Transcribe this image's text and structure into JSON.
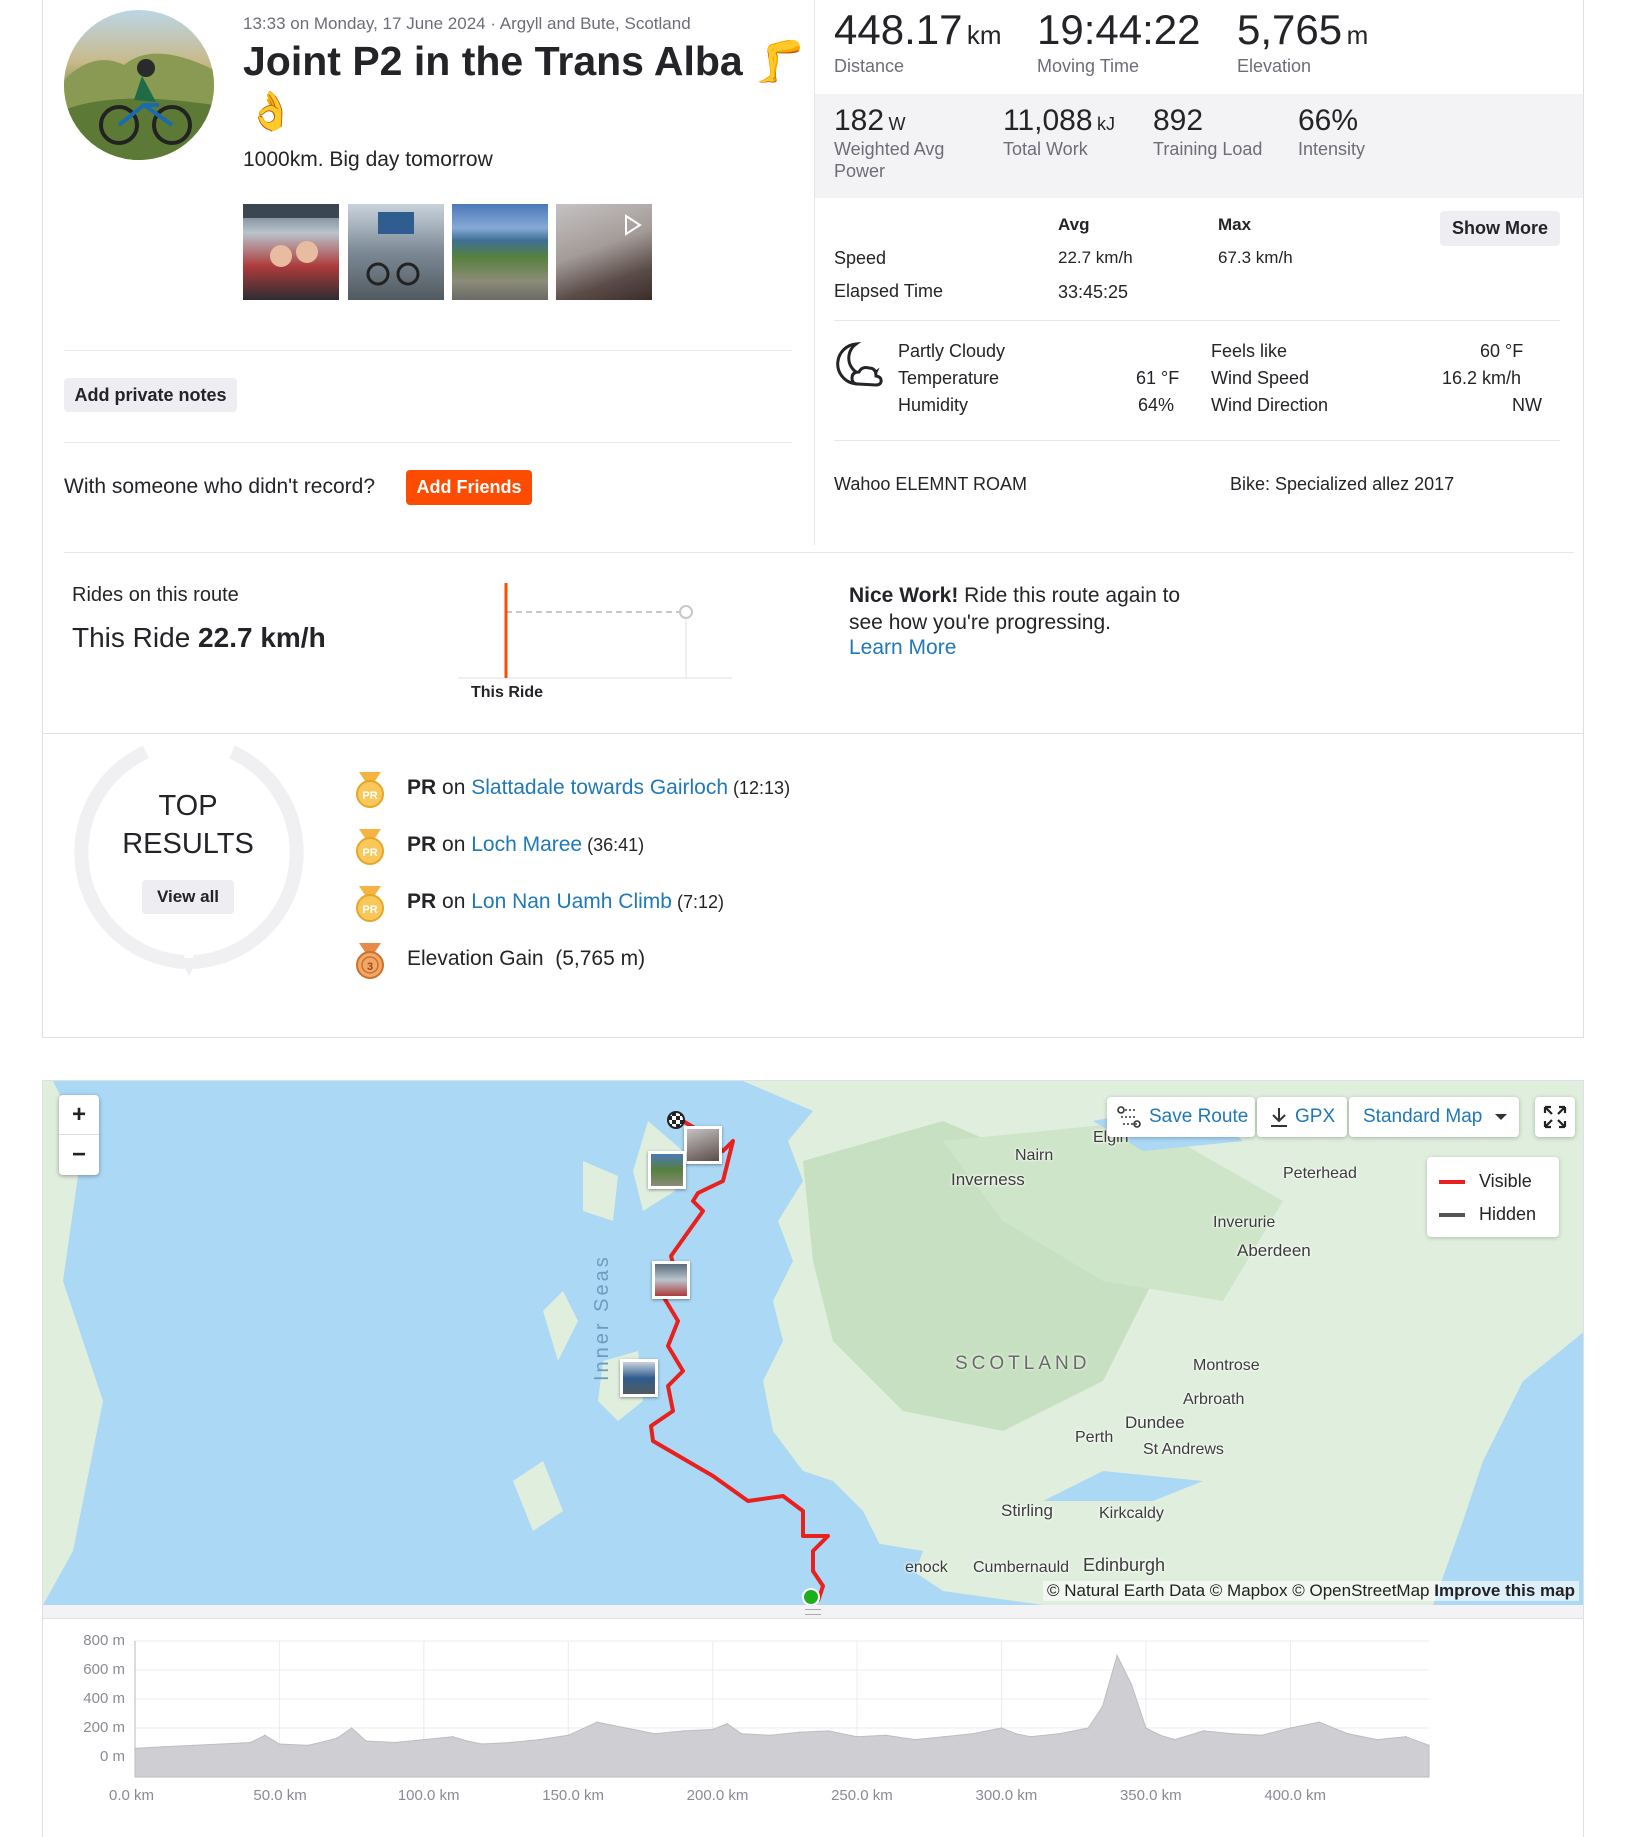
{
  "activity": {
    "meta": "13:33 on Monday, 17 June 2024 · Argyll and Bute, Scotland",
    "title": "Joint P2 in the Trans Alba 🦵",
    "title_emoji2": "👌",
    "description": "1000km. Big day tomorrow"
  },
  "actions": {
    "private_notes": "Add private notes",
    "someone_text": "With someone who didn't record?",
    "add_friends": "Add Friends"
  },
  "primary_stats": [
    {
      "value": "448.17",
      "unit": "km",
      "label": "Distance"
    },
    {
      "value": "19:44:22",
      "unit": "",
      "label": "Moving Time"
    },
    {
      "value": "5,765",
      "unit": "m",
      "label": "Elevation"
    }
  ],
  "secondary_stats": [
    {
      "value": "182",
      "unit": "W",
      "label": "Weighted Avg Power"
    },
    {
      "value": "11,088",
      "unit": "kJ",
      "label": "Total Work"
    },
    {
      "value": "892",
      "unit": "",
      "label": "Training Load"
    },
    {
      "value": "66%",
      "unit": "",
      "label": "Intensity"
    }
  ],
  "details": {
    "avg_header": "Avg",
    "max_header": "Max",
    "show_more": "Show More",
    "speed_label": "Speed",
    "speed_avg": "22.7 km/h",
    "speed_max": "67.3 km/h",
    "elapsed_label": "Elapsed Time",
    "elapsed_avg": "33:45:25"
  },
  "weather": {
    "condition": "Partly Cloudy",
    "temp_label": "Temperature",
    "temp_value": "61 °F",
    "humidity_label": "Humidity",
    "humidity_value": "64%",
    "feels_label": "Feels like",
    "feels_value": "60 °F",
    "wind_speed_label": "Wind Speed",
    "wind_speed_value": "16.2 km/h",
    "wind_dir_label": "Wind Direction",
    "wind_dir_value": "NW"
  },
  "gear": {
    "device": "Wahoo ELEMNT ROAM",
    "bike": "Bike: Specialized allez 2017"
  },
  "route": {
    "title": "Rides on this route",
    "this_ride_prefix": "This Ride",
    "this_ride_value": "22.7 km/h",
    "chart_label": "This Ride",
    "nice_work_bold": "Nice Work!",
    "nice_work_rest": " Ride this route again to see how you're progressing.",
    "learn_more": "Learn More"
  },
  "top_results": {
    "title_line1": "TOP",
    "title_line2": "RESULTS",
    "view_all": "View all",
    "items": [
      {
        "badge": "PR",
        "prefix": "PR",
        "on": " on ",
        "segment": "Slattadale towards Gairloch",
        "time": " (12:13)"
      },
      {
        "badge": "PR",
        "prefix": "PR",
        "on": " on ",
        "segment": "Loch Maree",
        "time": " (36:41)"
      },
      {
        "badge": "PR",
        "prefix": "PR",
        "on": " on ",
        "segment": "Lon Nan Uamh Climb",
        "time": " (7:12)"
      },
      {
        "badge": "3",
        "prefix": "",
        "on": "",
        "segment": "Elevation Gain  (5,765 m)",
        "time": ""
      }
    ]
  },
  "map": {
    "zoom_in": "+",
    "zoom_out": "−",
    "save_route": "Save Route",
    "gpx": "GPX",
    "map_type": "Standard Map",
    "legend_visible": "Visible",
    "legend_hidden": "Hidden",
    "attribution": "© Natural Earth Data © Mapbox © OpenStreetMap",
    "improve": "Improve this map",
    "sea_label": "Inner Seas",
    "country_label": "SCOTLAND",
    "cities": [
      "Elgin",
      "Nairn",
      "Inverness",
      "Peterhead",
      "Inverurie",
      "Aberdeen",
      "Montrose",
      "Arbroath",
      "Dundee",
      "Perth",
      "St Andrews",
      "Stirling",
      "Kirkcaldy",
      "Cumbernauld",
      "Edinburgh",
      "enock"
    ],
    "colors": {
      "visible": "#e8211e",
      "hidden": "#555555",
      "water": "#aad8f5",
      "land": "#dfeedd"
    }
  },
  "elevation_chart": {
    "y_ticks": [
      "800 m",
      "600 m",
      "400 m",
      "200 m",
      "0 m"
    ],
    "x_ticks": [
      "0.0 km",
      "50.0 km",
      "100.0 km",
      "150.0 km",
      "200.0 km",
      "250.0 km",
      "300.0 km",
      "350.0 km",
      "400.0 km"
    ]
  },
  "chart_data": {
    "type": "area",
    "xlabel": "",
    "ylabel": "",
    "xlim": [
      0,
      448
    ],
    "ylim": [
      0,
      800
    ],
    "x": [
      0,
      10,
      20,
      30,
      40,
      45,
      50,
      60,
      70,
      75,
      80,
      90,
      100,
      110,
      115,
      120,
      130,
      140,
      150,
      160,
      165,
      170,
      180,
      190,
      200,
      205,
      210,
      220,
      230,
      240,
      250,
      260,
      270,
      280,
      290,
      300,
      305,
      310,
      320,
      330,
      335,
      340,
      345,
      350,
      355,
      360,
      370,
      380,
      390,
      400,
      410,
      420,
      430,
      440,
      448
    ],
    "y": [
      60,
      70,
      80,
      90,
      100,
      150,
      90,
      80,
      130,
      200,
      110,
      100,
      120,
      140,
      110,
      90,
      100,
      120,
      150,
      240,
      220,
      200,
      160,
      180,
      190,
      230,
      160,
      150,
      170,
      180,
      140,
      150,
      120,
      140,
      160,
      200,
      160,
      140,
      160,
      200,
      350,
      700,
      500,
      200,
      150,
      120,
      180,
      160,
      150,
      200,
      240,
      160,
      120,
      140,
      80
    ]
  }
}
